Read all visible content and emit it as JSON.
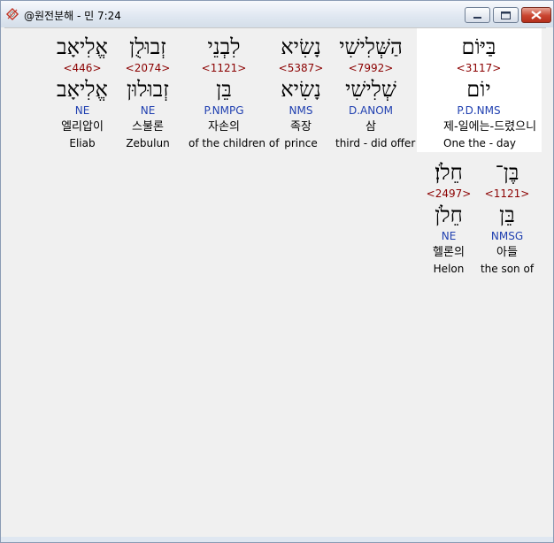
{
  "window": {
    "title": "@원전분해 - 민 7:24"
  },
  "row1": [
    {
      "heb": "בַּיּוֹם",
      "strong": "<3117>",
      "lemma": "יוֹם",
      "morph": "P.D.NMS",
      "kor": "제-일에는-드렸으니",
      "eng": "One the - day"
    },
    {
      "heb": "הַשְּׁלִישִׁי",
      "strong": "<7992>",
      "lemma": "שְׁלִישִׁי",
      "morph": "D.ANOM",
      "kor": "삼",
      "eng": "third - did offer"
    },
    {
      "heb": "נָשִׂיא",
      "strong": "<5387>",
      "lemma": "נָשִׂיא",
      "morph": "NMS",
      "kor": "족장",
      "eng": "prince"
    },
    {
      "heb": "לִבְנֵי",
      "strong": "<1121>",
      "lemma": "בֵּן",
      "morph": "P.NMPG",
      "kor": "자손의",
      "eng": "of the children of"
    },
    {
      "heb": "זְבוּלֻן",
      "strong": "<2074>",
      "lemma": "זְבוּלוּן",
      "morph": "NE",
      "kor": "스불론",
      "eng": "Zebulun"
    },
    {
      "heb": "אֱלִיאָב",
      "strong": "<446>",
      "lemma": "אֱלִיאָב",
      "morph": "NE",
      "kor": "엘리압이",
      "eng": "Eliab"
    }
  ],
  "row2": [
    {
      "heb": "בֶּן־",
      "strong": "<1121>",
      "lemma": "בֵּן",
      "morph": "NMSG",
      "kor": "아들",
      "eng": "the son of"
    },
    {
      "heb": "חֵלֹן׃",
      "strong": "<2497>",
      "lemma": "חֵלֹן",
      "morph": "NE",
      "kor": "헬론의",
      "eng": "Helon"
    }
  ]
}
